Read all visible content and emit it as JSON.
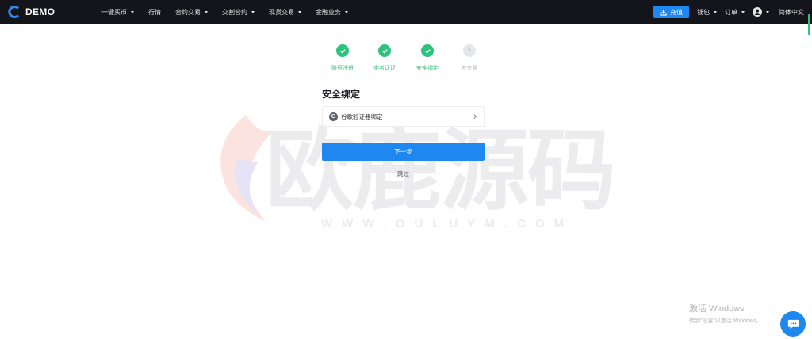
{
  "header": {
    "brand": "DEMO",
    "nav": [
      {
        "label": "一键买币",
        "caret": true
      },
      {
        "label": "行情",
        "caret": false
      },
      {
        "label": "合约交易",
        "caret": true
      },
      {
        "label": "交割合约",
        "caret": true
      },
      {
        "label": "现货交易",
        "caret": true
      },
      {
        "label": "金融业务",
        "caret": true
      }
    ],
    "recharge_label": "充值",
    "wallet_label": "钱包",
    "orders_label": "订单",
    "language_label": "简体中文"
  },
  "watermark": {
    "text": "欧鹿源码",
    "url": "WWW.OULUYM.COM"
  },
  "steps": [
    {
      "label": "账号注册",
      "status": "done"
    },
    {
      "label": "实名认证",
      "status": "done"
    },
    {
      "label": "安全绑定",
      "status": "done"
    },
    {
      "label": "去交易",
      "status": "todo",
      "number": "4"
    }
  ],
  "form": {
    "title": "安全绑定",
    "option_label": "谷歌验证器绑定",
    "option_icon_letter": "G",
    "next_label": "下一步",
    "skip_label": "跳过"
  },
  "system": {
    "activate_title": "激活 Windows",
    "activate_sub": "转到\"设置\"以激活 Windows。"
  },
  "colors": {
    "primary": "#1e88f0",
    "success": "#2ec27e",
    "header_bg": "#14151a"
  }
}
